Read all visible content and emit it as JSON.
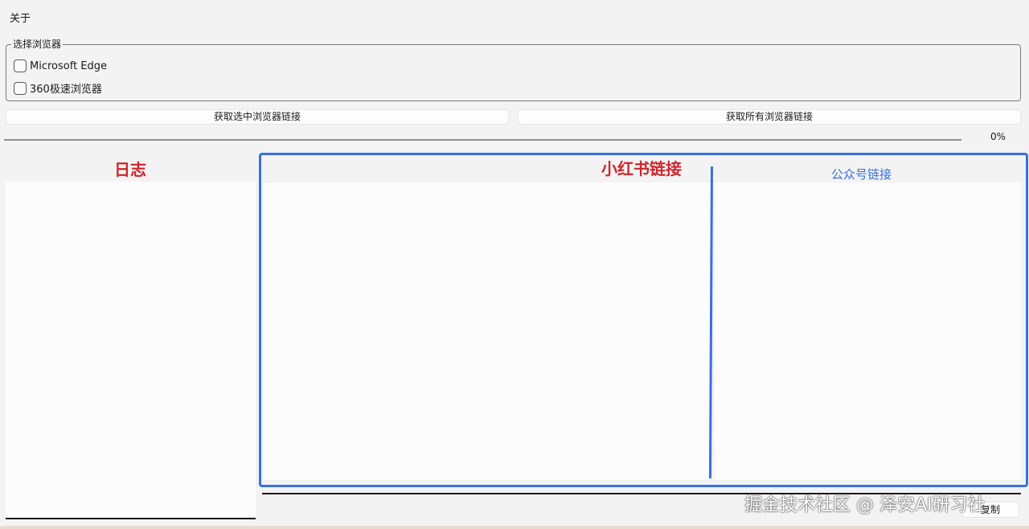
{
  "menubar": {
    "about": "关于"
  },
  "browser_group": {
    "title": "选择浏览器",
    "options": [
      {
        "label": "Microsoft Edge",
        "checked": false
      },
      {
        "label": "360极速浏览器",
        "checked": false
      }
    ]
  },
  "buttons": {
    "get_selected": "获取选中浏览器链接",
    "get_all": "获取所有浏览器链接",
    "copy": "复制"
  },
  "progress": {
    "value": 0,
    "text": "0%"
  },
  "panels": {
    "log_label": "日志",
    "xhs_label": "小红书链接",
    "gzh_label": "公众号链接"
  },
  "watermark": "掘金技术社区 @ 泽安AI研习社",
  "colors": {
    "accent_red": "#d0262d",
    "accent_blue": "#3a6fe0"
  }
}
